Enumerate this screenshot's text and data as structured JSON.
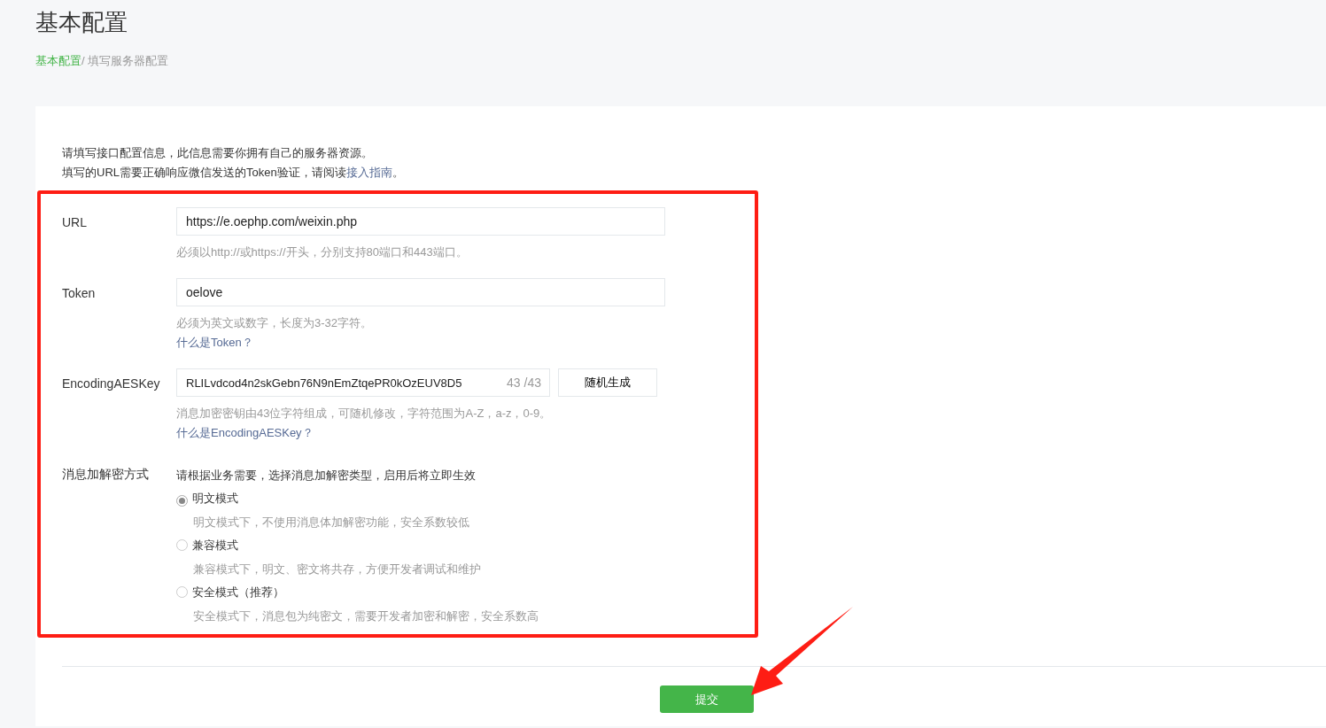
{
  "page_title": "基本配置",
  "breadcrumb": [
    {
      "label": "基本配置",
      "selected": false
    },
    {
      "label": "/ 填写服务器配置",
      "selected": true
    }
  ],
  "intro": {
    "line_1": "请填写接口配置信息，此信息需要你拥有自己的服务器资源。",
    "line_2": "填写的URL需要正确响应微信发送的Token验证，请阅读",
    "link": "接入指南",
    "tail": "。"
  },
  "fields": [
    {
      "kind": "text",
      "label": "URL",
      "value": "https://e.oephp.com/weixin.php",
      "hint": "必须以http://或https://开头，分别支持80端口和443端口。"
    },
    {
      "kind": "text",
      "label": "Token",
      "value": "oelove",
      "hint": "必须为英文或数字，长度为3-32字符。",
      "help_link": "什么是Token？"
    },
    {
      "kind": "key",
      "label": "EncodingAESKey",
      "value": "RLILvdcod4n2skGebn76N9nEmZtqePR0kOzEUV8D5",
      "counter": "43 /43",
      "button": "随机生成",
      "hint": "消息加密密钥由43位字符组成，可随机修改，字符范围为A-Z，a-z，0-9。",
      "help_link": "什么是EncodingAESKey？"
    }
  ],
  "encryption": {
    "label": "消息加解密方式",
    "description": "请根据业务需要，选择消息加解密类型，启用后将立即生效",
    "options": [
      {
        "label": "明文模式",
        "description": "明文模式下，不使用消息体加解密功能，安全系数较低",
        "selected": true
      },
      {
        "label": "兼容模式",
        "description": "兼容模式下，明文、密文将共存，方便开发者调试和维护",
        "selected": false
      },
      {
        "label": "安全模式（推荐）",
        "description": "安全模式下，消息包为纯密文，需要开发者加密和解密，安全系数高",
        "selected": false
      }
    ]
  },
  "submit": "提交"
}
